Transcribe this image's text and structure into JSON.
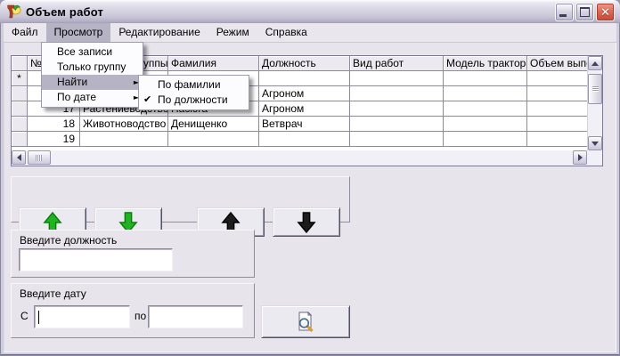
{
  "window": {
    "title": "Объем работ",
    "app_icon": "delphi-7-icon",
    "buttons": {
      "minimize": "minimize-icon",
      "maximize": "maximize-icon",
      "close": "close-icon"
    }
  },
  "menubar": {
    "items": [
      {
        "label": "Файл",
        "active": false
      },
      {
        "label": "Просмотр",
        "active": true
      },
      {
        "label": "Редактирование",
        "active": false
      },
      {
        "label": "Режим",
        "active": false
      },
      {
        "label": "Справка",
        "active": false
      }
    ]
  },
  "view_menu": {
    "items": [
      {
        "label": "Все записи",
        "has_submenu": false,
        "highlighted": false
      },
      {
        "label": "Только группу",
        "has_submenu": false,
        "highlighted": false
      },
      {
        "label": "Найти",
        "has_submenu": true,
        "highlighted": true
      },
      {
        "label": "По дате",
        "has_submenu": true,
        "highlighted": false
      }
    ]
  },
  "find_submenu": {
    "items": [
      {
        "label": "По фамилии",
        "checked": false
      },
      {
        "label": "По должности",
        "checked": true
      }
    ]
  },
  "grid": {
    "columns": [
      "№",
      "Название группы",
      "Фамилия",
      "Должность",
      "Вид работ",
      "Модель трактора",
      "Объем выполнения"
    ],
    "rows": [
      {
        "indicator": "*",
        "num": "",
        "group": "",
        "surname": "",
        "position": "",
        "work": "",
        "tractor": "",
        "volume": ""
      },
      {
        "indicator": "",
        "num": "",
        "group": "",
        "surname": "",
        "position": "Агроном",
        "work": "",
        "tractor": "",
        "volume": ""
      },
      {
        "indicator": "",
        "num": "17",
        "group": "Растениеводство",
        "surname": "Пасюга",
        "position": "Агроном",
        "work": "",
        "tractor": "",
        "volume": ""
      },
      {
        "indicator": "",
        "num": "18",
        "group": "Животноводство",
        "surname": "Денищенко",
        "position": "Ветврач",
        "work": "",
        "tractor": "",
        "volume": ""
      },
      {
        "indicator": "",
        "num": "19",
        "group": "",
        "surname": "",
        "position": "",
        "work": "",
        "tractor": "",
        "volume": ""
      }
    ]
  },
  "nav_buttons": [
    {
      "icon": "green-up-arrow-icon"
    },
    {
      "icon": "green-down-arrow-icon"
    },
    {
      "icon": "black-up-arrow-icon"
    },
    {
      "icon": "black-down-arrow-icon"
    }
  ],
  "position_panel": {
    "label": "Введите должность",
    "value": ""
  },
  "date_panel": {
    "label": "Введите дату",
    "from_label": "С",
    "to_label": "по",
    "from_value": "",
    "to_value": ""
  },
  "preview_button": {
    "icon": "print-preview-icon"
  },
  "colors": {
    "green_arrow": "#1db41d",
    "green_arrow_stroke": "#0a7a0a",
    "black_arrow": "#1c1c1c",
    "black_arrow_stroke": "#000000",
    "menu_highlight": "#b6b3c4",
    "close_button": "#d0513e",
    "client_background": "#e7e4eb"
  }
}
